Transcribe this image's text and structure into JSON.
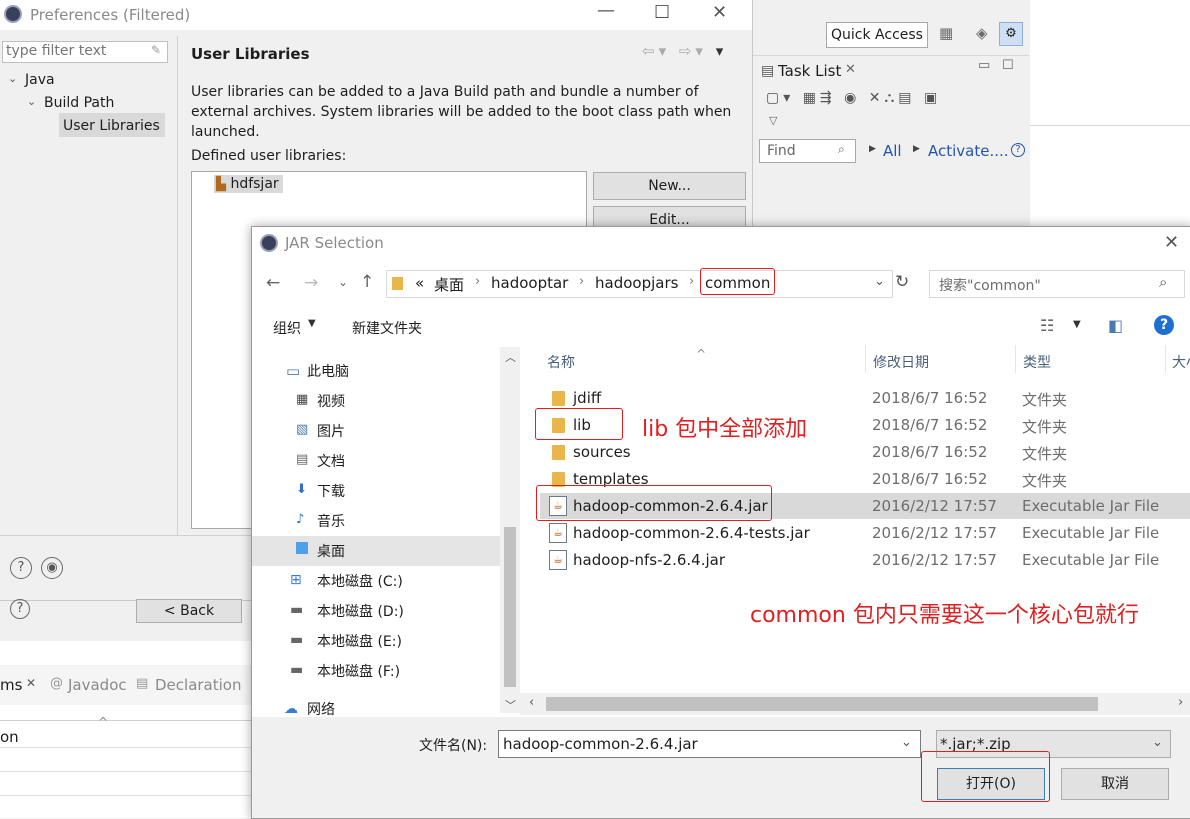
{
  "preferences": {
    "title": "Preferences (Filtered)",
    "filter_placeholder": "type filter text",
    "tree": {
      "java": "Java",
      "build_path": "Build Path",
      "user_libraries": "User Libraries"
    },
    "page_title": "User Libraries",
    "description": "User libraries can be added to a Java Build path and bundle a number of external archives. System libraries will be added to the boot class path when launched.",
    "defined_label": "Defined user libraries:",
    "library": "hdfsjar",
    "new_button": "New...",
    "edit_button": "Edit...",
    "back_button": "< Back"
  },
  "eclipse": {
    "quick_access": "Quick Access",
    "task_list": "Task List",
    "find_placeholder": "Find",
    "all_link": "All",
    "activate_link": "Activate....",
    "help_glyph": "?",
    "bottom_tabs": {
      "problems_tail": "ms",
      "javadoc": "Javadoc",
      "declaration": "Declaration"
    },
    "column_tail": "on"
  },
  "jar_dialog": {
    "title": "JAR Selection",
    "breadcrumb": [
      "«",
      "桌面",
      "hadooptar",
      "hadoopjars",
      "common"
    ],
    "search_placeholder": "搜索\"common\"",
    "organize": "组织",
    "new_folder": "新建文件夹",
    "nav_items": [
      "此电脑",
      "视频",
      "图片",
      "文档",
      "下载",
      "音乐",
      "桌面",
      "本地磁盘 (C:)",
      "本地磁盘 (D:)",
      "本地磁盘 (E:)",
      "本地磁盘 (F:)",
      "网络"
    ],
    "columns": {
      "name": "名称",
      "date": "修改日期",
      "type": "类型",
      "size": "大小"
    },
    "files": [
      {
        "name": "jdiff",
        "date": "2018/6/7 16:52",
        "type": "文件夹",
        "kind": "folder"
      },
      {
        "name": "lib",
        "date": "2018/6/7 16:52",
        "type": "文件夹",
        "kind": "folder"
      },
      {
        "name": "sources",
        "date": "2018/6/7 16:52",
        "type": "文件夹",
        "kind": "folder"
      },
      {
        "name": "templates",
        "date": "2018/6/7 16:52",
        "type": "文件夹",
        "kind": "folder"
      },
      {
        "name": "hadoop-common-2.6.4.jar",
        "date": "2016/2/12 17:57",
        "type": "Executable Jar File",
        "kind": "jar",
        "selected": true
      },
      {
        "name": "hadoop-common-2.6.4-tests.jar",
        "date": "2016/2/12 17:57",
        "type": "Executable Jar File",
        "kind": "jar"
      },
      {
        "name": "hadoop-nfs-2.6.4.jar",
        "date": "2016/2/12 17:57",
        "type": "Executable Jar File",
        "kind": "jar"
      }
    ],
    "filename_label": "文件名(N):",
    "filename_value": "hadoop-common-2.6.4.jar",
    "filetype_value": "*.jar;*.zip",
    "open_button": "打开(O)",
    "cancel_button": "取消"
  },
  "annotations": {
    "lib_note": "lib 包中全部添加",
    "common_note": "common 包内只需要这一个核心包就行"
  },
  "colors": {
    "annotation_red": "#e02020",
    "link_blue": "#2355b0",
    "selection_gray": "#d9d9d9"
  }
}
